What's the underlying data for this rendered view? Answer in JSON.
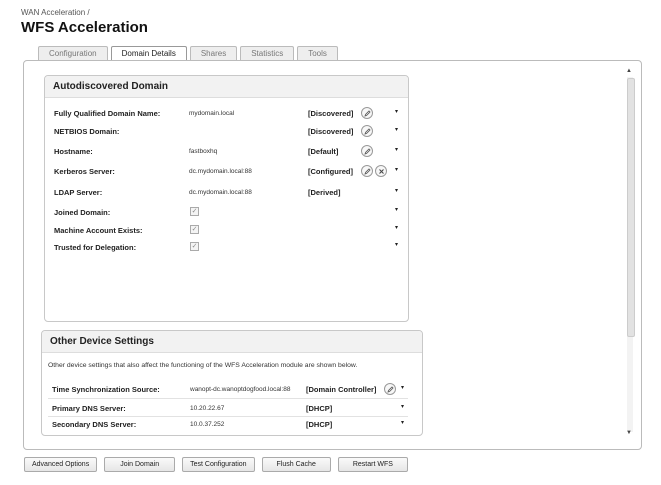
{
  "breadcrumb": "WAN Acceleration /",
  "title": "WFS Acceleration",
  "tabs": [
    {
      "label": "Configuration"
    },
    {
      "label": "Domain Details"
    },
    {
      "label": "Shares"
    },
    {
      "label": "Statistics"
    },
    {
      "label": "Tools"
    }
  ],
  "autodiscovered": {
    "title": "Autodiscovered Domain",
    "rows": [
      {
        "label": "Fully Qualified Domain Name:",
        "value": "mydomain.local",
        "status": "[Discovered]"
      },
      {
        "label": "NETBIOS Domain:",
        "value": "",
        "status": "[Discovered]"
      },
      {
        "label": "Hostname:",
        "value": "fastboxhq",
        "status": "[Default]"
      },
      {
        "label": "Kerberos Server:",
        "value": "dc.mydomain.local:88",
        "status": "[Configured]"
      },
      {
        "label": "LDAP Server:",
        "value": "dc.mydomain.local:88",
        "status": "[Derived]"
      },
      {
        "label": "Joined Domain:",
        "value": "",
        "status": ""
      },
      {
        "label": "Machine Account Exists:",
        "value": "",
        "status": ""
      },
      {
        "label": "Trusted for Delegation:",
        "value": "",
        "status": ""
      }
    ]
  },
  "other_settings": {
    "title": "Other Device Settings",
    "description": "Other device settings that also affect the functioning of the WFS Acceleration module are shown below.",
    "rows": [
      {
        "label": "Time Synchronization Source:",
        "value": "wanopt-dc.wanoptdogfood.local:88",
        "status": "[Domain Controller]"
      },
      {
        "label": "Primary DNS Server:",
        "value": "10.20.22.67",
        "status": "[DHCP]"
      },
      {
        "label": "Secondary DNS Server:",
        "value": "10.0.37.252",
        "status": "[DHCP]"
      }
    ]
  },
  "buttons": {
    "advanced": "Advanced Options",
    "join": "Join Domain",
    "test": "Test Configuration",
    "flush": "Flush Cache",
    "restart": "Restart WFS"
  },
  "icons": {
    "edit": "pencil-icon",
    "clear": "close-icon",
    "caret": "caret-icon",
    "check": "checkbox-icon"
  }
}
